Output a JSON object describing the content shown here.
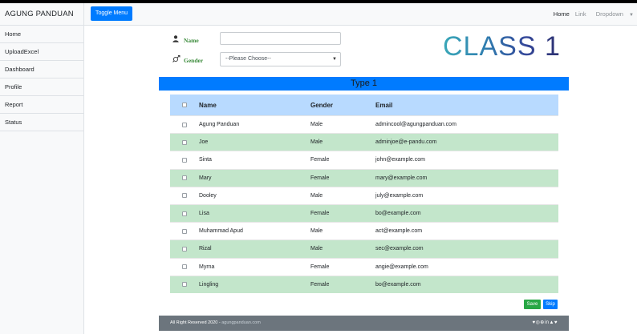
{
  "sidebar": {
    "brand": "AGUNG PANDUAN",
    "items": [
      {
        "label": "Home"
      },
      {
        "label": "UploadExcel"
      },
      {
        "label": "Dashboard"
      },
      {
        "label": "Profile"
      },
      {
        "label": "Report"
      },
      {
        "label": "Status"
      }
    ]
  },
  "topbar": {
    "toggle_label": "Toggle Menu",
    "home": "Home",
    "link": "Link",
    "dropdown": "Dropdown"
  },
  "form": {
    "name_label": "Name",
    "name_value": "",
    "gender_label": "Gender",
    "gender_selected": "--Please Choose--"
  },
  "class_title": "CLASS 1",
  "type_header": "Type 1",
  "table": {
    "headers": {
      "name": "Name",
      "gender": "Gender",
      "email": "Email"
    },
    "rows": [
      {
        "name": "Agung Panduan",
        "gender": "Male",
        "email": "admincool@agungpanduan.com"
      },
      {
        "name": "Joe",
        "gender": "Male",
        "email": "adminjoe@e-pandu.com"
      },
      {
        "name": "Sinta",
        "gender": "Female",
        "email": "john@example.com"
      },
      {
        "name": "Mary",
        "gender": "Female",
        "email": "mary@example.com"
      },
      {
        "name": "Dooley",
        "gender": "Male",
        "email": "july@example.com"
      },
      {
        "name": "Lisa",
        "gender": "Female",
        "email": "bo@example.com"
      },
      {
        "name": "Muhammad Apud",
        "gender": "Male",
        "email": "act@example.com"
      },
      {
        "name": "Rizal",
        "gender": "Male",
        "email": "sec@example.com"
      },
      {
        "name": "Myrna",
        "gender": "Female",
        "email": "angie@example.com"
      },
      {
        "name": "Lingling",
        "gender": "Female",
        "email": "bo@example.com"
      }
    ]
  },
  "actions": {
    "save_label": "Save",
    "skip_label": "Skip"
  },
  "footer": {
    "text": "All Right Reserved 2020 - ",
    "link": "agungpanduan.com",
    "socials": "♥◎⊕in▲♥"
  },
  "colors": {
    "primary": "#007bff",
    "success": "#28a745",
    "row_alt": "#c3e6cb",
    "table_head": "#b8daff",
    "footer": "#6c757d",
    "label_green": "#3a8a3a"
  },
  "icons": {
    "name_field": "user-icon",
    "gender_field": "gender-icon"
  }
}
